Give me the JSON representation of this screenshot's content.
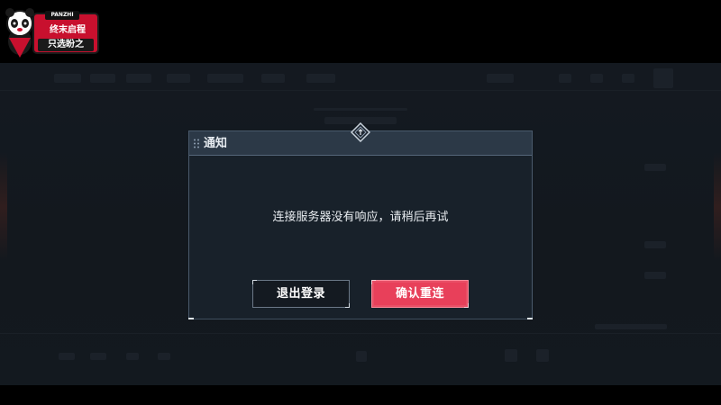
{
  "badge": {
    "tag": "PANZHI",
    "line1": "终末启程",
    "line2": "只选盼之"
  },
  "dialog": {
    "title": "通知",
    "message": "连接服务器没有响应，请稍后再试",
    "buttons": {
      "logout_label": "退出登录",
      "confirm_label": "确认重连"
    }
  },
  "colors": {
    "letterbox": "#000000",
    "background": "#1b2029",
    "dialog_bg": "#19212b",
    "header_bg": "#2c3947",
    "confirm_button": "#e8405a",
    "logout_button": "#141a21",
    "badge_red": "#c8102e"
  },
  "icons": {
    "emblem": "diamond-emblem-icon",
    "grip": "drag-grip-icon",
    "mascot": "panda-mascot-icon"
  }
}
